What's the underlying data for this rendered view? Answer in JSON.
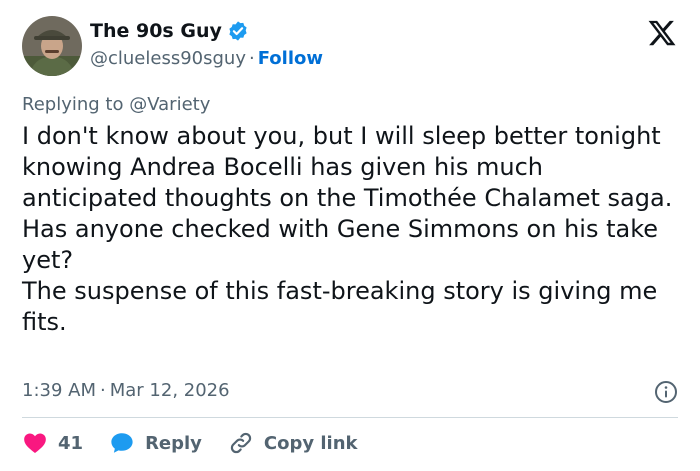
{
  "author": {
    "name": "The 90s Guy",
    "handle": "@clueless90sguy",
    "separator": "·",
    "follow_label": "Follow"
  },
  "reply": {
    "prefix": "Replying to",
    "mention": "@Variety"
  },
  "tweet": {
    "line1": "I don't know about you, but I will sleep better tonight knowing Andrea Bocelli has given his much anticipated thoughts on the Timothée Chalamet saga.",
    "line2": "Has anyone checked with Gene Simmons on his take yet?",
    "line3": "The suspense of this fast-breaking story is giving me fits."
  },
  "meta": {
    "time": "1:39 AM",
    "separator": "·",
    "date": "Mar 12, 2026"
  },
  "actions": {
    "like_count": "41",
    "reply_label": "Reply",
    "copy_link_label": "Copy link"
  },
  "colors": {
    "like": "#f91880",
    "reply_icon": "#1d9bf0",
    "follow": "#006fd6",
    "verified": "#1d9bf0"
  },
  "icons": [
    "verified-badge-icon",
    "x-logo-icon",
    "info-icon",
    "heart-icon",
    "speech-bubble-icon",
    "link-icon"
  ]
}
